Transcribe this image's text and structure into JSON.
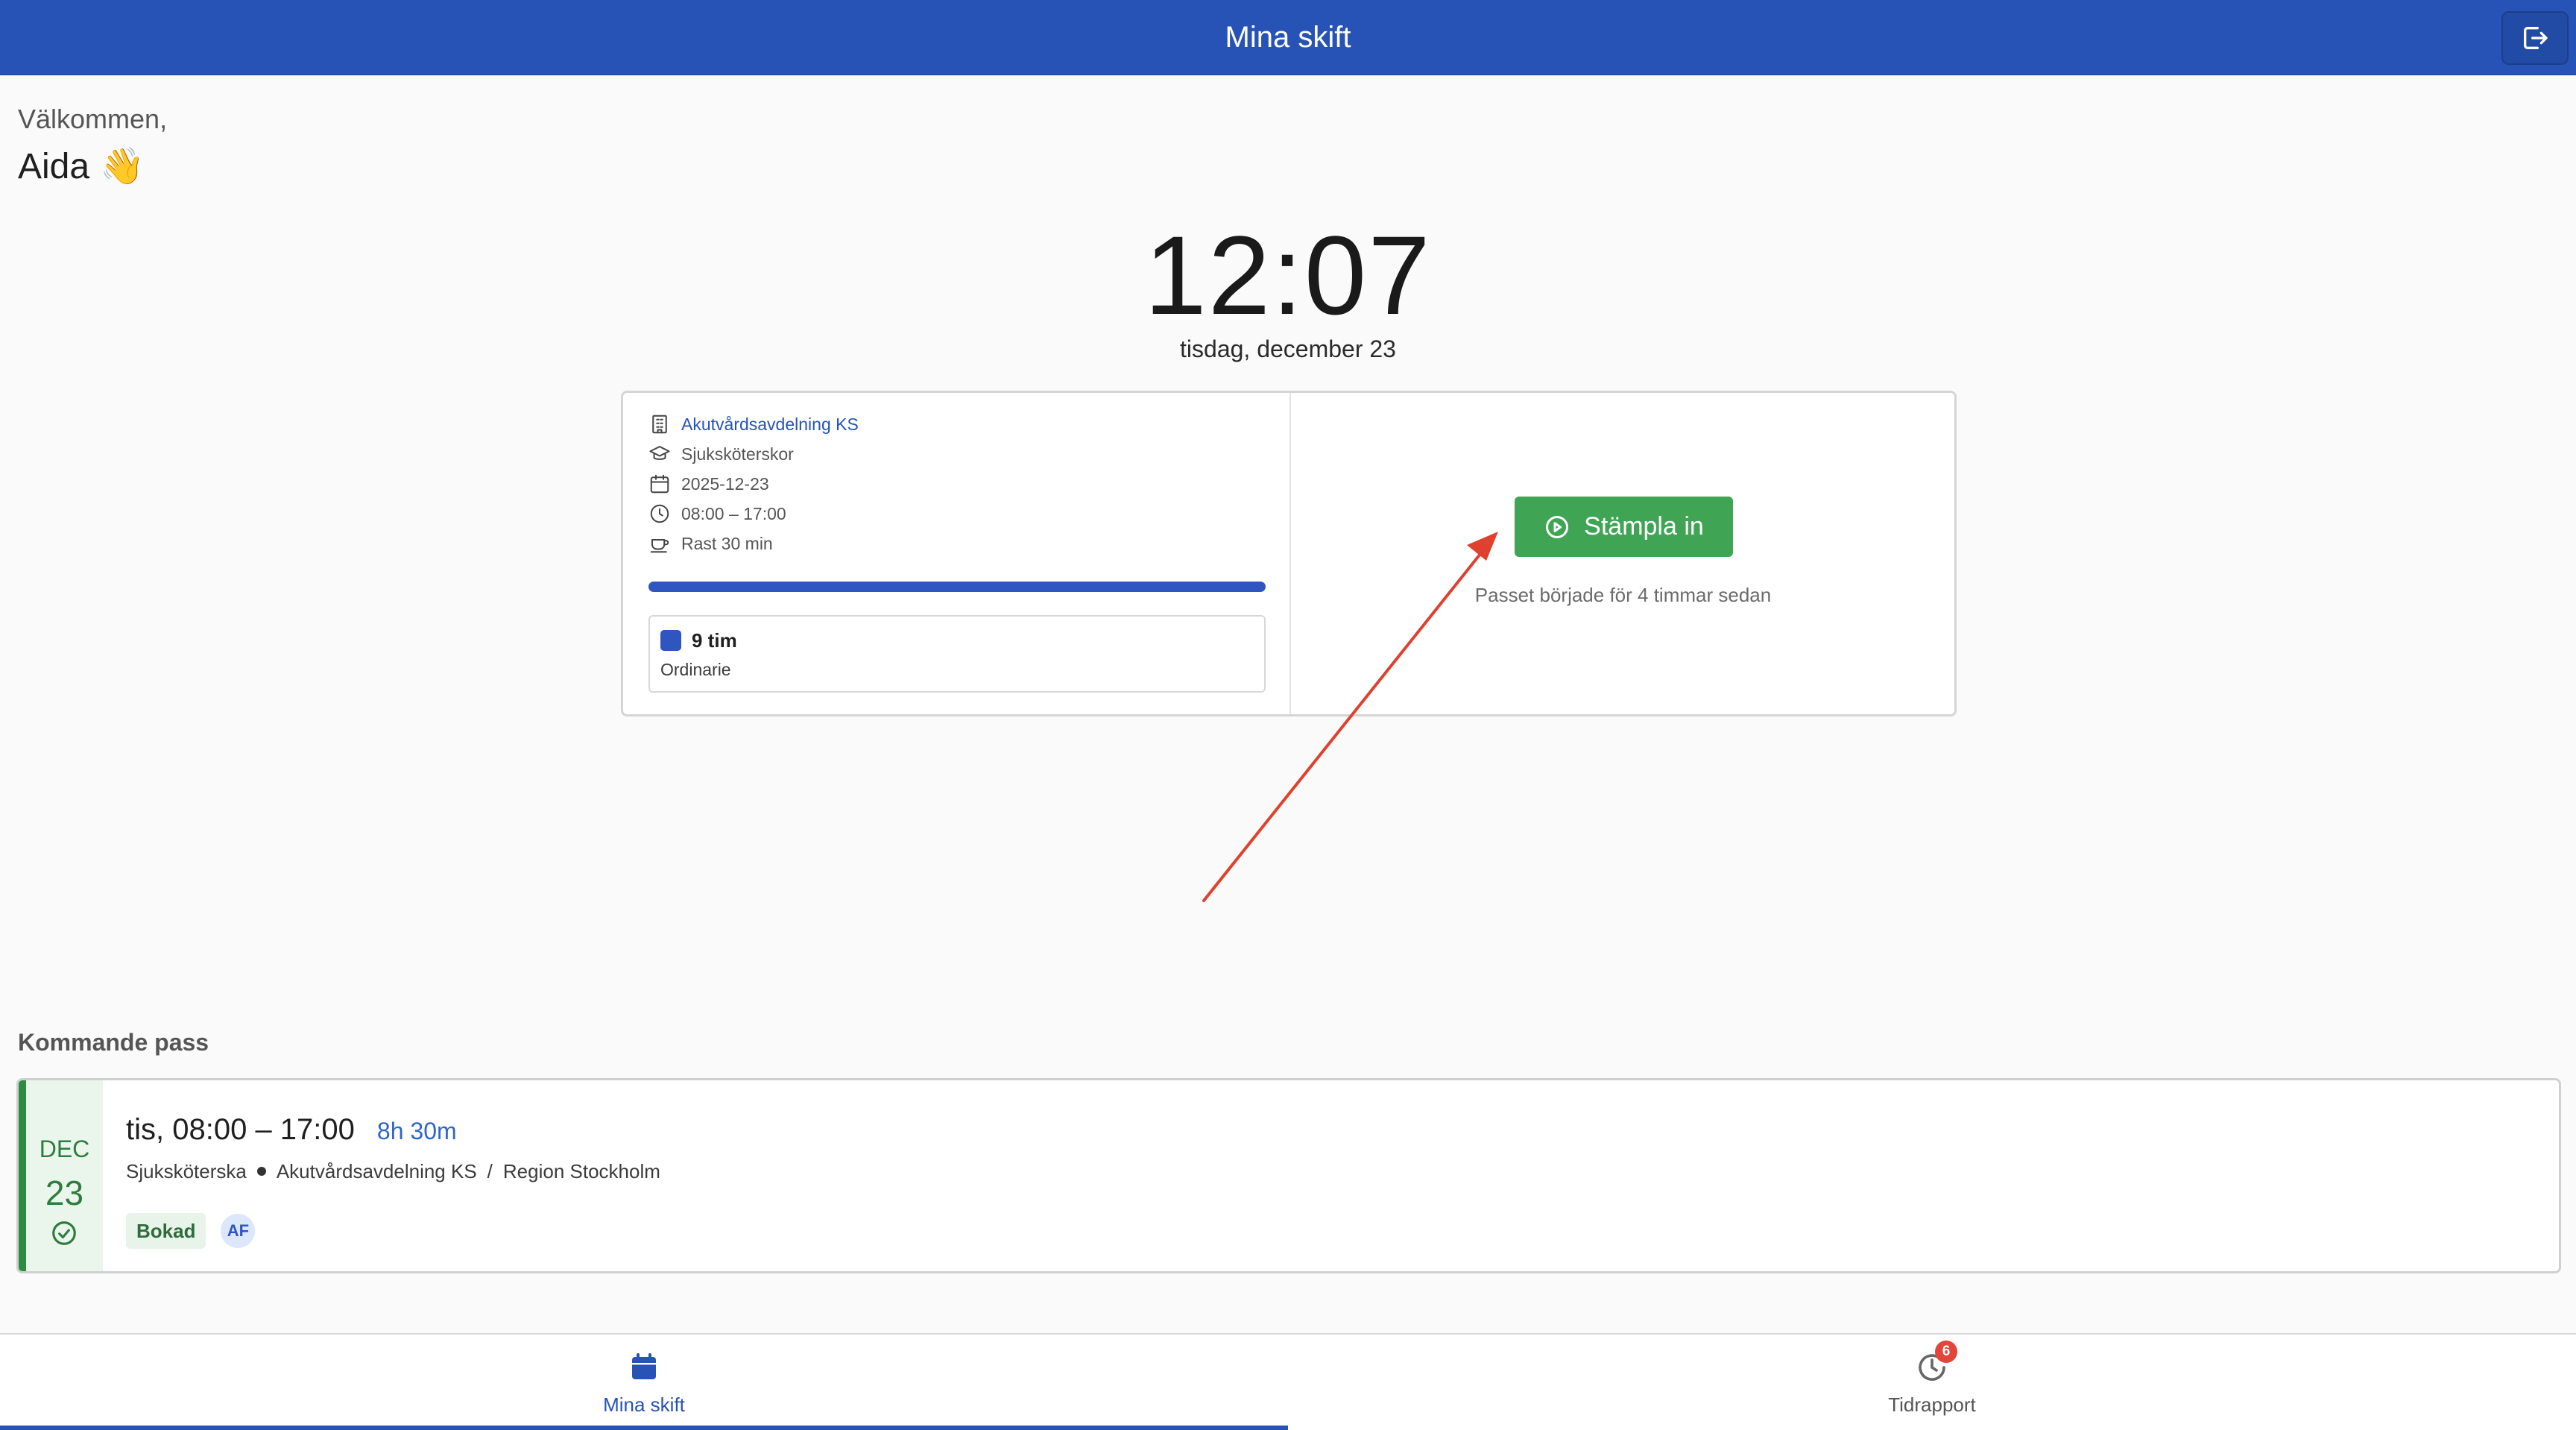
{
  "header": {
    "title": "Mina skift",
    "logout_icon": "logout-icon"
  },
  "greeting": {
    "line1": "Välkommen,",
    "name": "Aida",
    "emoji": "👋"
  },
  "clock": {
    "time": "12:07",
    "date": "tisdag, december 23"
  },
  "shift": {
    "department": "Akutvårdsavdelning KS",
    "role": "Sjuksköterskor",
    "date": "2025-12-23",
    "hours": "08:00 – 17:00",
    "break": "Rast 30 min",
    "progress_fraction": 1.0,
    "summary_hours": "9 tim",
    "summary_type": "Ordinarie",
    "clock_in_label": "Stämpla in",
    "started_text": "Passet började för 4 timmar sedan"
  },
  "upcoming": {
    "title": "Kommande pass",
    "items": [
      {
        "month": "DEC",
        "day": "23",
        "time": "tis, 08:00 – 17:00",
        "duration": "8h 30m",
        "role": "Sjuksköterska",
        "department": "Akutvårdsavdelning KS",
        "separator": "/",
        "region": "Region Stockholm",
        "status": "Bokad",
        "avatar_initials": "AF"
      }
    ]
  },
  "nav": {
    "items": [
      {
        "label": "Mina skift",
        "icon": "calendar-icon",
        "active": true
      },
      {
        "label": "Tidrapport",
        "icon": "clock-history-icon",
        "badge": "6"
      }
    ]
  },
  "colors": {
    "primary": "#2653b5",
    "success": "#3fa554",
    "badge": "#e2463a",
    "annotation_arrow": "#e0402e"
  }
}
